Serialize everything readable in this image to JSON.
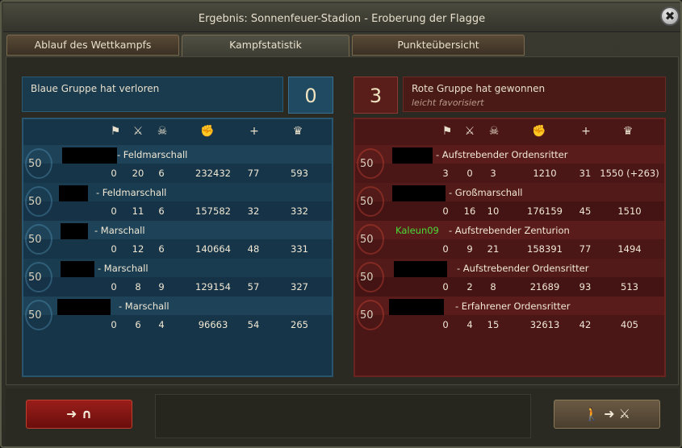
{
  "window": {
    "title": "Ergebnis: Sonnenfeuer-Stadion - Eroberung der Flagge",
    "close_label": "✖"
  },
  "tabs": [
    {
      "label": "Ablauf des Wettkampfs",
      "active": false
    },
    {
      "label": "Kampfstatistik",
      "active": true
    },
    {
      "label": "Punkteübersicht",
      "active": false
    }
  ],
  "column_icons": [
    "flag-icon",
    "crossed-swords-icon",
    "skull-icon",
    "fist-icon",
    "plus-icon",
    "crown-icon"
  ],
  "column_glyphs": [
    "⚑",
    "⚔",
    "☠",
    "✊",
    "+",
    "♛"
  ],
  "blue_team": {
    "header": "Blaue Gruppe hat verloren",
    "score": "0",
    "color": "#1a3a4e",
    "players": [
      {
        "level": "50",
        "rank": "- Feldmarschall",
        "stats": [
          "0",
          "20",
          "6",
          "232432",
          "77",
          "593"
        ]
      },
      {
        "level": "50",
        "rank": "- Feldmarschall",
        "stats": [
          "0",
          "11",
          "6",
          "157582",
          "32",
          "332"
        ]
      },
      {
        "level": "50",
        "rank": "- Marschall",
        "stats": [
          "0",
          "12",
          "6",
          "140664",
          "48",
          "331"
        ]
      },
      {
        "level": "50",
        "rank": "- Marschall",
        "stats": [
          "0",
          "8",
          "9",
          "129154",
          "57",
          "327"
        ]
      },
      {
        "level": "50",
        "rank": "- Marschall",
        "stats": [
          "0",
          "6",
          "4",
          "96663",
          "54",
          "265"
        ]
      }
    ]
  },
  "red_team": {
    "header": "Rote Gruppe hat gewonnen",
    "subheader": "leicht favorisiert",
    "score": "3",
    "color": "#4a1616",
    "players": [
      {
        "level": "50",
        "name": "",
        "rank": "- Aufstrebender Ordensritter",
        "stats": [
          "3",
          "0",
          "3",
          "1210",
          "31",
          "1550 (+263)"
        ]
      },
      {
        "level": "50",
        "name": "",
        "rank": "- Großmarschall",
        "stats": [
          "0",
          "16",
          "10",
          "176159",
          "45",
          "1510"
        ]
      },
      {
        "level": "50",
        "name": "Kaleun09",
        "rank": "- Aufstrebender Zenturion",
        "stats": [
          "0",
          "9",
          "21",
          "158391",
          "77",
          "1494"
        ]
      },
      {
        "level": "50",
        "name": "",
        "rank": "- Aufstrebender Ordensritter",
        "stats": [
          "0",
          "2",
          "8",
          "21689",
          "93",
          "513"
        ]
      },
      {
        "level": "50",
        "name": "",
        "rank": "- Erfahrener Ordensritter",
        "stats": [
          "0",
          "4",
          "15",
          "32613",
          "42",
          "405"
        ]
      }
    ]
  },
  "footer": {
    "leave_label": "➜ ∩",
    "join_label": "🚶 ➜ ⚔"
  }
}
